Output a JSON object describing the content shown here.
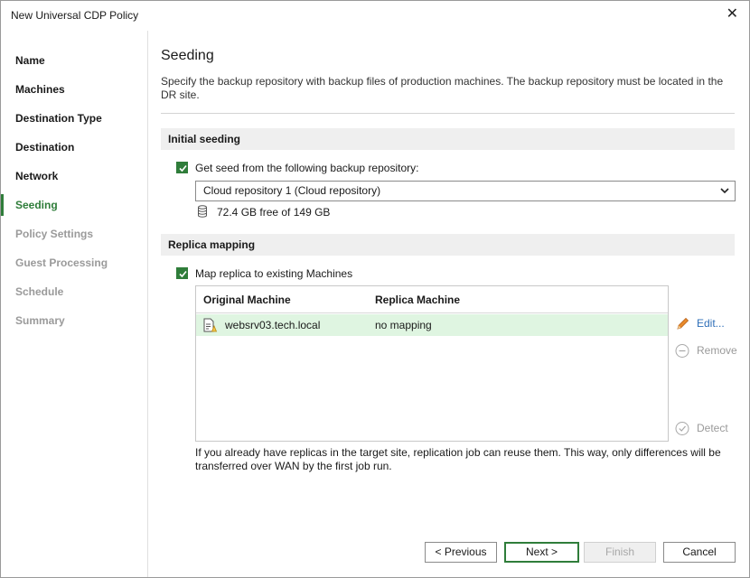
{
  "window": {
    "title": "New Universal CDP Policy"
  },
  "steps": [
    {
      "label": "Name",
      "state": "done"
    },
    {
      "label": "Machines",
      "state": "done"
    },
    {
      "label": "Destination Type",
      "state": "done"
    },
    {
      "label": "Destination",
      "state": "done"
    },
    {
      "label": "Network",
      "state": "done"
    },
    {
      "label": "Seeding",
      "state": "active"
    },
    {
      "label": "Policy Settings",
      "state": "future"
    },
    {
      "label": "Guest Processing",
      "state": "future"
    },
    {
      "label": "Schedule",
      "state": "future"
    },
    {
      "label": "Summary",
      "state": "future"
    }
  ],
  "page": {
    "heading": "Seeding",
    "description": "Specify the backup repository with backup files of production machines. The backup repository must be located in the DR site."
  },
  "initial_seeding": {
    "section_title": "Initial seeding",
    "checkbox_label": "Get seed from the following backup repository:",
    "checked": true,
    "repository_selected": "Cloud repository 1 (Cloud repository)",
    "free_space": "72.4 GB free of 149 GB"
  },
  "replica_mapping": {
    "section_title": "Replica mapping",
    "checkbox_label": "Map replica to existing Machines",
    "checked": true,
    "columns": [
      "Original Machine",
      "Replica Machine"
    ],
    "rows": [
      {
        "original": "websrv03.tech.local",
        "replica": "no mapping"
      }
    ],
    "edit_label": "Edit...",
    "remove_label": "Remove",
    "detect_label": "Detect",
    "note": "If you already have replicas in the target site, replication job can reuse them. This way, only differences will be transferred over WAN by the first job run."
  },
  "footer": {
    "previous": "< Previous",
    "next": "Next >",
    "finish": "Finish",
    "cancel": "Cancel"
  },
  "colors": {
    "accent": "#2f7d3a",
    "row_highlight": "#dff5e1",
    "link": "#2f6fb8",
    "disabled": "#9a9a9a"
  },
  "icons": {
    "close": "close-icon",
    "checkbox": "checkmark-icon",
    "dropdown": "chevron-down-icon",
    "storage": "database-icon",
    "machine": "server-icon",
    "edit": "pencil-icon",
    "remove": "minus-circle-icon",
    "detect": "check-circle-icon"
  }
}
